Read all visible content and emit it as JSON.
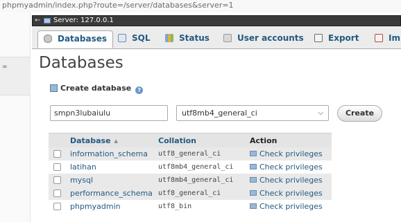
{
  "browser": {
    "url": "phpmyadmin/index.php?route=/server/databases&server=1"
  },
  "server": {
    "label": "Server: 127.0.0.1"
  },
  "tabs": [
    {
      "label": "Databases",
      "icon": "database-icon",
      "active": true
    },
    {
      "label": "SQL",
      "icon": "sql-icon"
    },
    {
      "label": "Status",
      "icon": "status-icon"
    },
    {
      "label": "User accounts",
      "icon": "users-icon"
    },
    {
      "label": "Export",
      "icon": "export-icon"
    },
    {
      "label": "Im",
      "icon": "import-icon"
    }
  ],
  "page": {
    "title": "Databases",
    "create_label": "Create database"
  },
  "form": {
    "db_name_value": "smpn3lubaiulu",
    "collation": "utf8mb4_general_ci",
    "create_button": "Create"
  },
  "table": {
    "headers": {
      "database": "Database",
      "collation": "Collation",
      "action": "Action"
    },
    "rows": [
      {
        "name": "information_schema",
        "collation": "utf8_general_ci",
        "action": "Check privileges"
      },
      {
        "name": "latihan",
        "collation": "utf8mb4_general_ci",
        "action": "Check privileges"
      },
      {
        "name": "mysql",
        "collation": "utf8mb4_general_ci",
        "action": "Check privileges"
      },
      {
        "name": "performance_schema",
        "collation": "utf8_general_ci",
        "action": "Check privileges"
      },
      {
        "name": "phpmyadmin",
        "collation": "utf8_bin",
        "action": "Check privileges"
      }
    ]
  },
  "colors": {
    "link": "#235a81",
    "server_bar": "#3a3a3a",
    "tab_bg": "#ececec"
  }
}
